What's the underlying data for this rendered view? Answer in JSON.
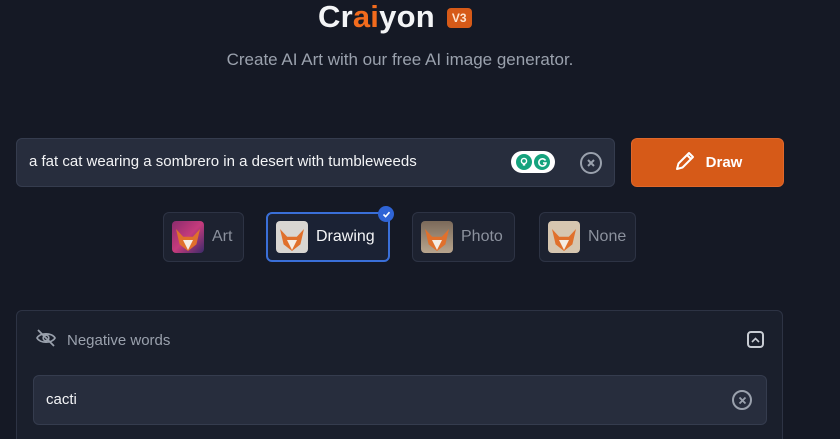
{
  "header": {
    "logo_prefix": "Cr",
    "logo_accent": "ai",
    "logo_suffix": "yon",
    "version": "V3",
    "subtitle": "Create AI Art with our free AI image generator."
  },
  "prompt": {
    "value": "a fat cat wearing a sombrero in a desert with tumbleweeds",
    "clear_icon": "close-circle-icon"
  },
  "draw_button": {
    "label": "Draw",
    "icon": "pencil-icon"
  },
  "styles": [
    {
      "label": "Art",
      "selected": false
    },
    {
      "label": "Drawing",
      "selected": true
    },
    {
      "label": "Photo",
      "selected": false
    },
    {
      "label": "None",
      "selected": false
    }
  ],
  "negative": {
    "title": "Negative words",
    "icon": "eye-off-icon",
    "value": "cacti"
  },
  "colors": {
    "background": "#151925",
    "accent": "#d65a18",
    "selection": "#3a6fd8"
  }
}
